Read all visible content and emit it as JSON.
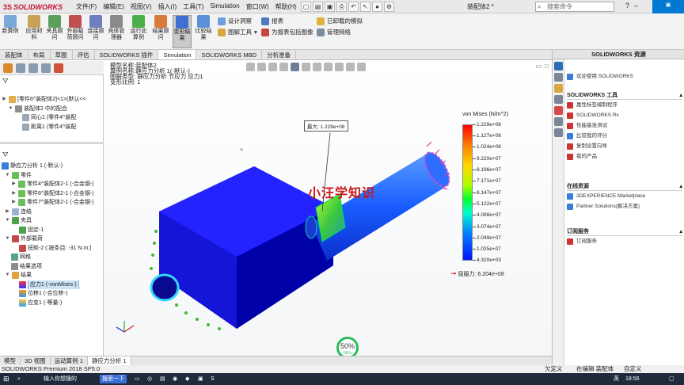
{
  "app": {
    "brand": "SOLIDWORKS",
    "doc_title": "装配体2 *",
    "search_placeholder": "搜索命令"
  },
  "menu": [
    "文件(F)",
    "编辑(E)",
    "视图(V)",
    "插入(I)",
    "工具(T)",
    "Simulation",
    "窗口(W)",
    "帮助(H)"
  ],
  "ribbon": {
    "big_buttons": [
      "新算例",
      "应用材料",
      "夹具顾问",
      "外部载荷顾问",
      "连接顾问",
      "壳体管理器",
      "运行此算例",
      "结果顾问",
      "变形结果",
      "比较结果"
    ],
    "rows": {
      "design_insight": "设计洞察",
      "plot_tools": "图解工具",
      "report": "报表",
      "include_image": "为报表包括图像",
      "unloaded_sim": "已卸载的模拟",
      "manage_network": "管理网络"
    }
  },
  "tabs": [
    "装配体",
    "布局",
    "草图",
    "评估",
    "SOLIDWORKS 插件",
    "Simulation",
    "SOLIDWORKS MBD",
    "分析准备"
  ],
  "active_tab": "Simulation",
  "feature_tree": {
    "rows": [
      {
        "label": "[零件6^装配体2]<1>(默认<<",
        "level": 0
      },
      {
        "label": "装配体2 中的配合",
        "level": 1
      },
      {
        "label": "同心1 (零件4^装配",
        "level": 2
      },
      {
        "label": "距离1 (零件4^装配",
        "level": 2
      }
    ]
  },
  "study_tree": {
    "rows": [
      {
        "label": "静应力分析 1 (-默认-)",
        "level": 0
      },
      {
        "label": "零件",
        "level": 1
      },
      {
        "label": "零件4^装配体2-1 (-合金钢-)",
        "level": 2
      },
      {
        "label": "零件6^装配体2-1 (-合金钢-)",
        "level": 2
      },
      {
        "label": "零件7^装配体2-1 (-合金钢-)",
        "level": 2
      },
      {
        "label": "连结",
        "level": 1
      },
      {
        "label": "夹具",
        "level": 1
      },
      {
        "label": "固定-1",
        "level": 2
      },
      {
        "label": "外部载荷",
        "level": 1
      },
      {
        "label": "扭矩-2 (:按条目: -31 N.m:)",
        "level": 2
      },
      {
        "label": "网格",
        "level": 1
      },
      {
        "label": "结果选项",
        "level": 1
      },
      {
        "label": "结果",
        "level": 1
      },
      {
        "label": "应力1 (-vonMises-)",
        "level": 2
      },
      {
        "label": "位移1 (-合位移-)",
        "level": 2
      },
      {
        "label": "应变1 (-等量-)",
        "level": 2
      }
    ],
    "selected": "应力1 (-vonMises-)"
  },
  "viewport_info": {
    "line1": "模型名称:装配体2",
    "line2": "算例名称:静应力分析 1(-默认-)",
    "line3": "图解类型: 静应力分析 节应力 应力1",
    "line4": "变形比例: 1"
  },
  "max_label": "最大: 1.229e+08",
  "watermark": "小汪学知识",
  "progress": {
    "percent": "50%",
    "speed": "0K/s"
  },
  "legend": {
    "title": "von Mises (N/m^2)",
    "ticks": [
      "1.229e+08",
      "1.127e+08",
      "1.024e+08",
      "9.220e+07",
      "8.196e+07",
      "7.171e+07",
      "6.147e+07",
      "5.122e+07",
      "4.098e+07",
      "3.074e+07",
      "2.049e+07",
      "1.025e+07",
      "4.320e+03"
    ],
    "yield_label": "屈服力: 6.204e+08"
  },
  "bottom_tabs": [
    "模型",
    "3D 视图",
    "运动算例 1",
    "静应力分析 1"
  ],
  "active_bottom_tab": "静应力分析 1",
  "status": {
    "left": "SOLIDWORKS Premium 2018 SP5.0",
    "right1": "欠定义",
    "right2": "在编辑 装配体",
    "right3": "自定义"
  },
  "taskbar": {
    "search": "输入你想搜的",
    "search2": "搜索一下",
    "time": "18:56",
    "lang": "英"
  },
  "task_pane": {
    "title": "SOLIDWORKS 资源",
    "welcome": "欢迎使用 SOLIDWORKS",
    "tools_header": "SOLIDWORKS 工具",
    "tools": [
      "属性标签编制程序",
      "SOLIDWORKS Rx",
      "性能基准测试",
      "比较我的评分",
      "复制设置向导",
      "我的产品"
    ],
    "online_header": "在线资源",
    "online": [
      "3DEXPERIENCE Marketplace",
      "Partner Solutions(解决方案)"
    ],
    "sub_header": "订阅服务",
    "sub": [
      "订阅服务"
    ]
  },
  "colors": {
    "accent": "#0079d3",
    "sw_red": "#c8102e",
    "model_blue": "#1a1aff"
  }
}
